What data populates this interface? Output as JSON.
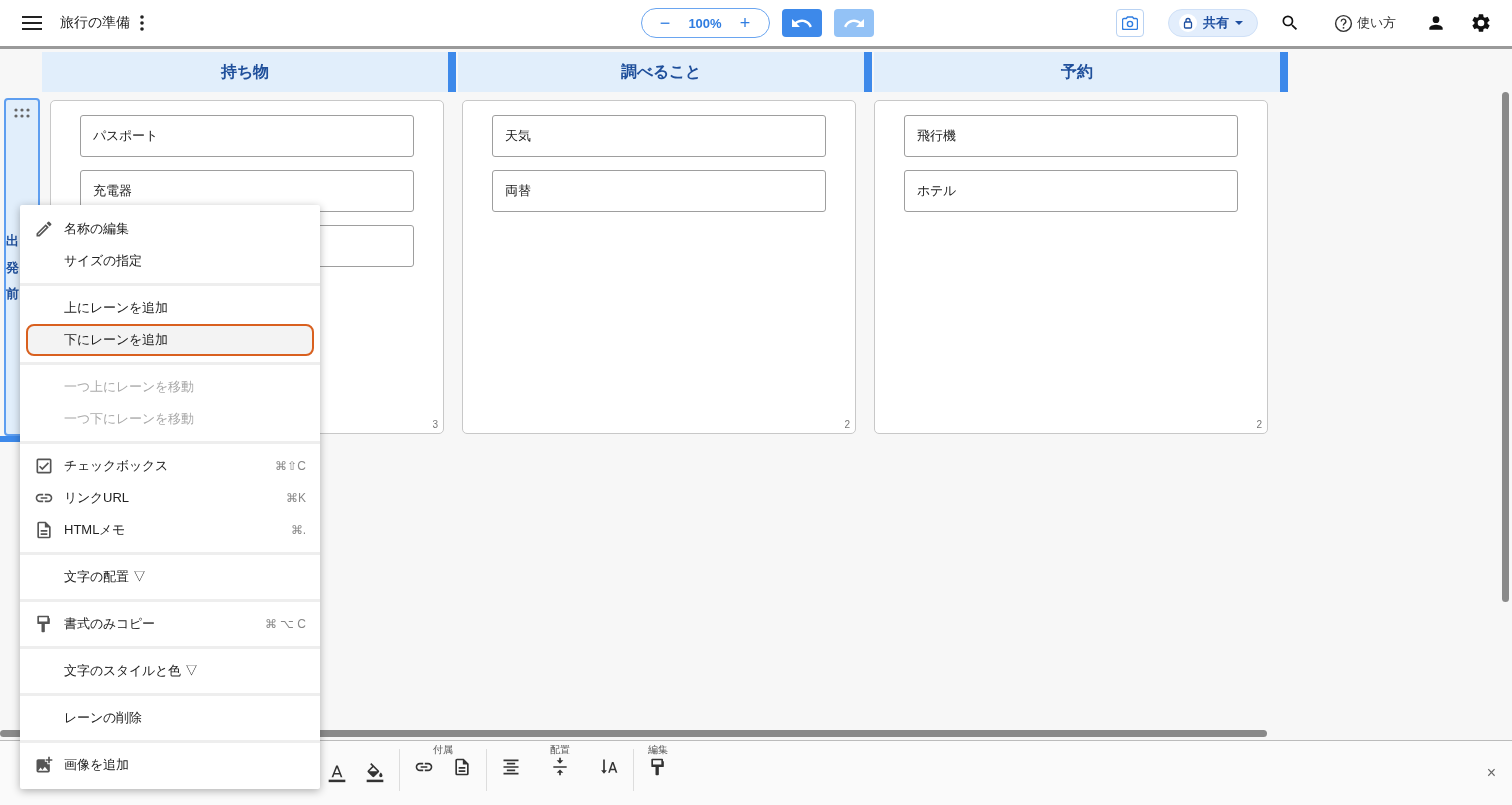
{
  "topbar": {
    "title": "旅行の準備",
    "zoom": {
      "minus": "−",
      "value": "100%",
      "plus": "+"
    },
    "undo": {
      "disabled": false
    },
    "redo": {
      "disabled": true
    },
    "share": {
      "label": "共有"
    },
    "help": {
      "label": "使い方"
    }
  },
  "columns": [
    {
      "title": "持ち物",
      "count": "3",
      "items": [
        {
          "kind": "text",
          "text": "パスポート"
        },
        {
          "kind": "text",
          "text": "充電器"
        },
        {
          "kind": "covered"
        }
      ]
    },
    {
      "title": "調べること",
      "count": "2",
      "items": [
        {
          "kind": "text",
          "text": "天気"
        },
        {
          "kind": "text",
          "text": "両替"
        }
      ]
    },
    {
      "title": "予約",
      "count": "2",
      "items": [
        {
          "kind": "text",
          "text": "飛行機"
        },
        {
          "kind": "text",
          "text": "ホテル"
        }
      ]
    }
  ],
  "lane": {
    "title": "出発前"
  },
  "context_menu": {
    "sections": [
      {
        "items": [
          {
            "kind": "pencil",
            "label": "名称の編集",
            "disabled": false,
            "selected": false
          },
          {
            "kind": "plain",
            "label": "サイズの指定",
            "disabled": false,
            "selected": false
          }
        ]
      },
      {
        "items": [
          {
            "kind": "plain",
            "label": "上にレーンを追加",
            "disabled": false,
            "selected": false
          },
          {
            "kind": "plain",
            "label": "下にレーンを追加",
            "disabled": false,
            "selected": true
          }
        ]
      },
      {
        "items": [
          {
            "kind": "plain",
            "label": "一つ上にレーンを移動",
            "disabled": true,
            "selected": false
          },
          {
            "kind": "plain",
            "label": "一つ下にレーンを移動",
            "disabled": true,
            "selected": false
          }
        ]
      },
      {
        "items": [
          {
            "kind": "checkbox",
            "label": "チェックボックス",
            "shortcut": "⌘⇧C",
            "disabled": false,
            "selected": false
          },
          {
            "kind": "link",
            "label": "リンクURL",
            "shortcut": "⌘K",
            "disabled": false,
            "selected": false
          },
          {
            "kind": "doc",
            "label": "HTMLメモ",
            "shortcut": "⌘.",
            "disabled": false,
            "selected": false
          }
        ]
      },
      {
        "items": [
          {
            "kind": "plain",
            "label": "文字の配置 ▽",
            "disabled": false,
            "selected": false
          }
        ]
      },
      {
        "items": [
          {
            "kind": "roller",
            "label": "書式のみコピー",
            "shortcut": "⌘ ⌥ C",
            "disabled": false,
            "selected": false
          }
        ]
      },
      {
        "items": [
          {
            "kind": "plain",
            "label": "文字のスタイルと色 ▽",
            "disabled": false,
            "selected": false
          }
        ]
      },
      {
        "items": [
          {
            "kind": "plain",
            "label": "レーンの削除",
            "disabled": false,
            "selected": false
          }
        ]
      },
      {
        "items": [
          {
            "kind": "image-add",
            "label": "画像を追加",
            "disabled": false,
            "selected": false
          }
        ]
      }
    ]
  },
  "toolbar": {
    "groups": [
      {
        "tools": [
          {
            "kind": "text-color"
          },
          {
            "kind": "fill"
          }
        ]
      },
      {
        "label": "付属",
        "tools": [
          {
            "kind": "link"
          },
          {
            "kind": "doc"
          }
        ]
      },
      {
        "label": "配置",
        "tools": [
          {
            "kind": "align-center"
          },
          {
            "kind": "compress"
          },
          {
            "kind": "text-direction"
          }
        ]
      },
      {
        "label": "編集",
        "tools": [
          {
            "kind": "roller"
          }
        ]
      }
    ],
    "close": "×"
  }
}
